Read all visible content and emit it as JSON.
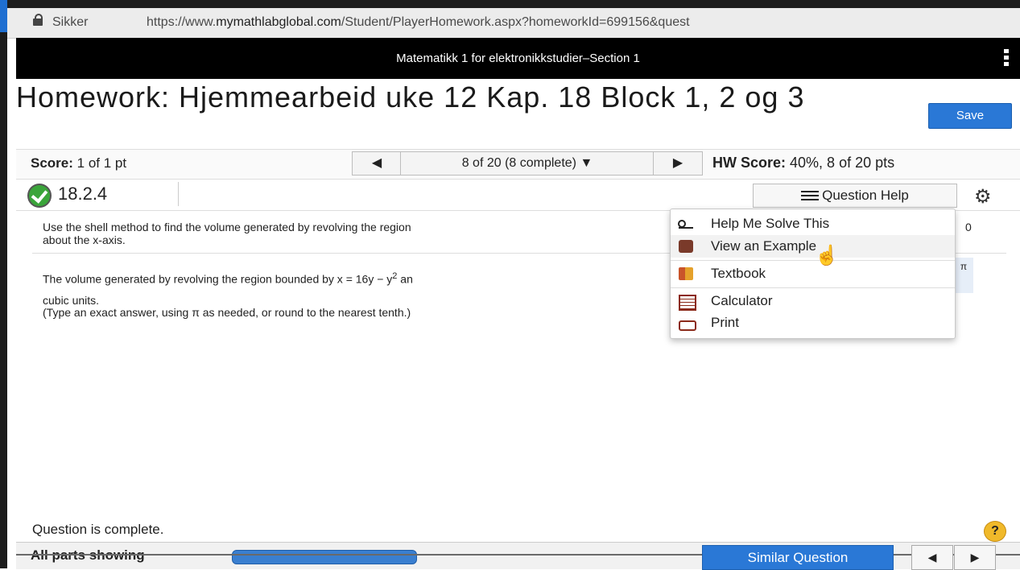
{
  "browser": {
    "secure_label": "Sikker",
    "url_prefix": "https://www.",
    "url_host": "mymathlabglobal.com",
    "url_path": "/Student/PlayerHomework.aspx?homeworkId=699156&quest"
  },
  "course": {
    "title": "Matematikk 1 for elektronikkstudier–Section 1"
  },
  "homework": {
    "title": "Homework: Hjemmearbeid uke 12 Kap. 18 Block 1, 2 og 3",
    "save_label": "Save"
  },
  "score": {
    "label": "Score:",
    "value": "1 of 1 pt",
    "nav_prev": "◀",
    "nav_position": "8 of 20 (8 complete) ▼",
    "nav_next": "▶",
    "hw_label": "HW Score:",
    "hw_value": "40%, 8 of 20 pts"
  },
  "question": {
    "number": "18.2.4",
    "help_label": "Question Help",
    "prompt": "Use the shell method to find the volume generated by revolving the region",
    "prompt_line2": "about the x-axis.",
    "prompt_tail": "0",
    "answer_text": "The volume generated by revolving the region bounded by x = 16y − y",
    "answer_sup": "2",
    "answer_after": " an",
    "inst1": "cubic units.",
    "inst2": "(Type an exact answer, using π as needed, or round to the nearest tenth.)",
    "pi_symbol": "π"
  },
  "help_menu": {
    "items": [
      {
        "label": "Help Me Solve This",
        "icon": "key-icon"
      },
      {
        "label": "View an Example",
        "icon": "binoculars-icon"
      },
      {
        "label": "Textbook",
        "icon": "textbook-icon"
      },
      {
        "label": "Calculator",
        "icon": "calculator-icon"
      },
      {
        "label": "Print",
        "icon": "print-icon"
      }
    ]
  },
  "footer": {
    "status": "Question is complete.",
    "hint": "?",
    "all_parts": "All parts showing",
    "similar": "Similar Question",
    "prev": "◀",
    "next": "▶"
  },
  "colors": {
    "accent": "#2a78d6",
    "header_bg": "#000000",
    "check": "#3aa53a",
    "hint": "#f0b92a"
  }
}
